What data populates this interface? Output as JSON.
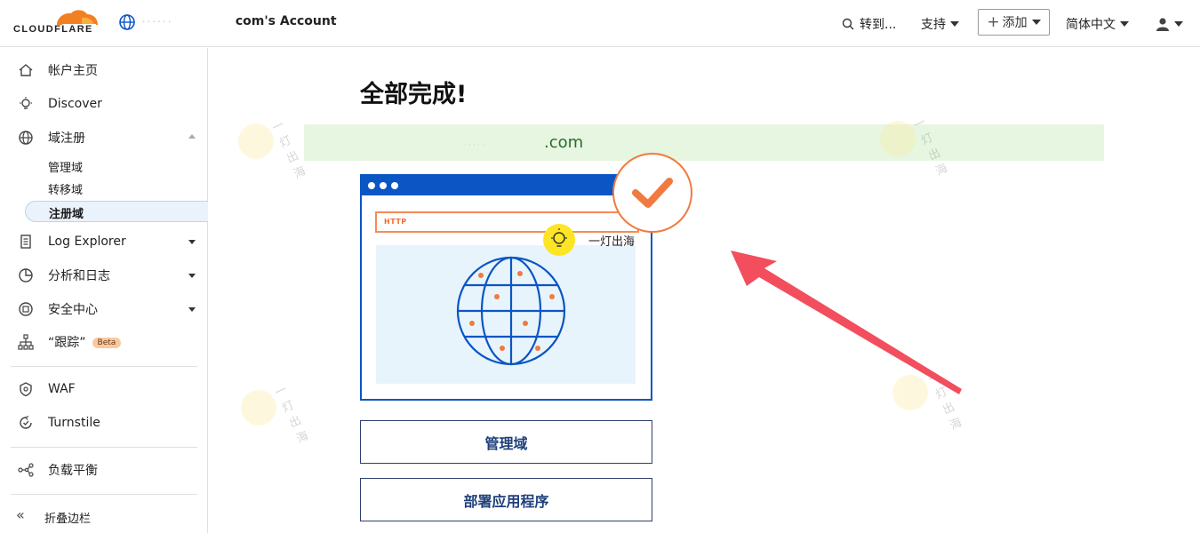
{
  "header": {
    "logo_text": "CLOUDFLARE",
    "account_name": "com's Account",
    "goto_label": "转到...",
    "support_label": "支持",
    "add_label": "添加",
    "language_label": "简体中文"
  },
  "sidebar": {
    "items": [
      {
        "label": "帐户主页",
        "icon": "home-icon"
      },
      {
        "label": "Discover",
        "icon": "lightbulb-icon"
      },
      {
        "label": "域注册",
        "icon": "globe-icon"
      },
      {
        "label": "Log Explorer",
        "icon": "document-icon"
      },
      {
        "label": "分析和日志",
        "icon": "chart-icon"
      },
      {
        "label": "安全中心",
        "icon": "shield-icon"
      },
      {
        "label": "“跟踪”",
        "icon": "tree-icon",
        "badge": "Beta"
      },
      {
        "label": "WAF",
        "icon": "waf-icon"
      },
      {
        "label": "Turnstile",
        "icon": "turnstile-icon"
      },
      {
        "label": "负载平衡",
        "icon": "network-icon"
      }
    ],
    "sub_items": [
      "管理域",
      "转移域",
      "注册域"
    ],
    "collapse_label": "折叠边栏"
  },
  "main": {
    "title": "全部完成!",
    "domain": ".com",
    "http_label": "HTTP",
    "watermark": "一灯出海",
    "buttons": [
      "管理域",
      "部署应用程序"
    ]
  },
  "colors": {
    "brand_orange": "#f38020",
    "accent_blue": "#0b55c5",
    "success_bg": "#e6f6e0",
    "annotation_arrow": "#f24e5e"
  }
}
